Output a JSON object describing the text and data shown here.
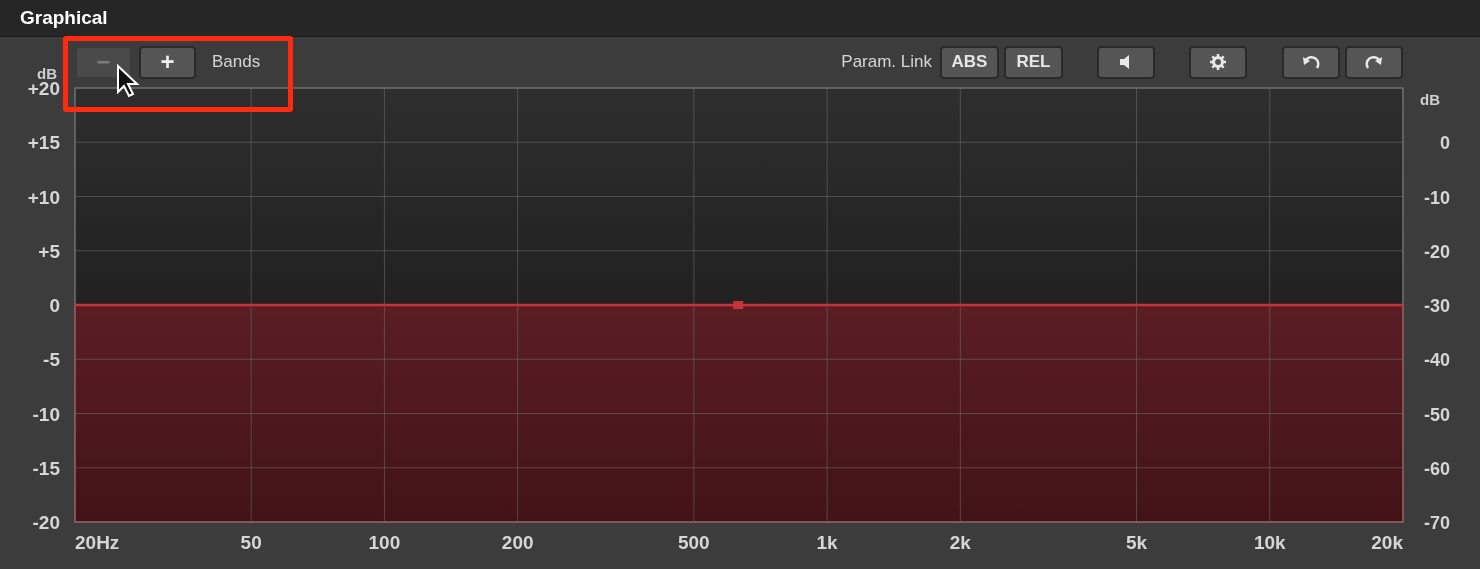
{
  "window": {
    "title": "Graphical"
  },
  "toolbar": {
    "band_buttons": [
      {
        "label": "−",
        "disabled": true
      },
      {
        "label": "+",
        "disabled": false
      }
    ],
    "bands_label": "Bands",
    "param_link_label": "Param. Link",
    "link_buttons": [
      {
        "label": "ABS"
      },
      {
        "label": "REL"
      }
    ],
    "tool_buttons": [
      {
        "kind": "speaker"
      },
      {
        "kind": "settings"
      },
      {
        "kind": "undo"
      },
      {
        "kind": "redo"
      }
    ]
  },
  "highlight": {
    "kind": "annotation-box"
  },
  "cursor": {
    "kind": "pointer"
  },
  "eq_graph": {
    "left_unit": "dB",
    "right_unit": "dB",
    "gain_labels": [
      "+20",
      "+15",
      "+10",
      "+5",
      "0",
      "-5",
      "-10",
      "-15",
      "-20"
    ],
    "right_labels": [
      "0",
      "-10",
      "-20",
      "-30",
      "-40",
      "-50",
      "-60",
      "-70"
    ],
    "frequency_labels": [
      "20Hz",
      "50",
      "100",
      "200",
      "500",
      "1k",
      "2k",
      "5k",
      "10k",
      "20k"
    ],
    "band_node": {
      "kind": "marker"
    }
  }
}
